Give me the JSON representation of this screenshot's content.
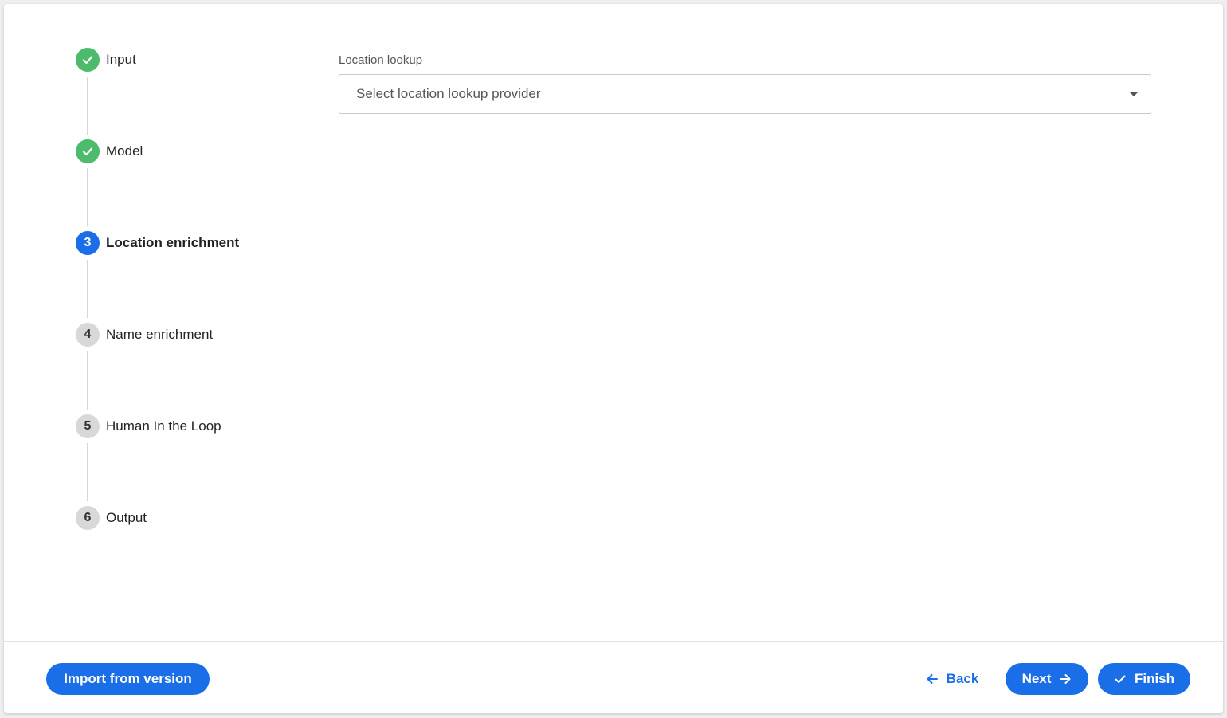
{
  "colors": {
    "primary": "#1a6fe8",
    "done": "#4cbb6c",
    "pending": "#d8d8d8"
  },
  "stepper": {
    "steps": [
      {
        "number": "1",
        "label": "Input",
        "state": "done",
        "icon": "check-icon"
      },
      {
        "number": "2",
        "label": "Model",
        "state": "done",
        "icon": "check-icon"
      },
      {
        "number": "3",
        "label": "Location enrichment",
        "state": "active"
      },
      {
        "number": "4",
        "label": "Name enrichment",
        "state": "pending"
      },
      {
        "number": "5",
        "label": "Human In the Loop",
        "state": "pending"
      },
      {
        "number": "6",
        "label": "Output",
        "state": "pending"
      }
    ]
  },
  "form": {
    "location_lookup": {
      "label": "Location lookup",
      "placeholder": "Select location lookup provider",
      "icon": "caret-down-icon"
    }
  },
  "footer": {
    "import_label": "Import from version",
    "back_label": "Back",
    "next_label": "Next",
    "finish_label": "Finish",
    "back_icon": "arrow-left-icon",
    "next_icon": "arrow-right-icon",
    "finish_icon": "check-icon"
  }
}
